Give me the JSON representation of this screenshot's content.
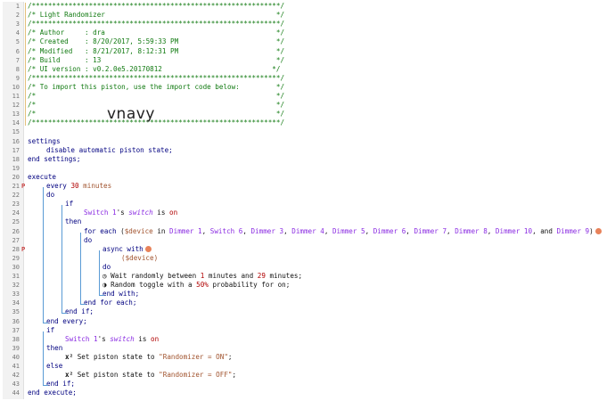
{
  "watermark": "vnavy",
  "lines": [
    {
      "n": "1",
      "indent": 0,
      "cls": "cm",
      "text": "/*************************************************************/"
    },
    {
      "n": "2",
      "indent": 0,
      "cls": "cm",
      "text": "/* Light Randomizer                                          */"
    },
    {
      "n": "3",
      "indent": 0,
      "cls": "cm",
      "text": "/*************************************************************/"
    },
    {
      "n": "4",
      "indent": 0,
      "cls": "cm",
      "text": "/* Author     : dra                                          */"
    },
    {
      "n": "5",
      "indent": 0,
      "cls": "cm",
      "text": "/* Created    : 8/20/2017, 5:59:33 PM                        */"
    },
    {
      "n": "6",
      "indent": 0,
      "cls": "cm",
      "text": "/* Modified   : 8/21/2017, 8:12:31 PM                        */"
    },
    {
      "n": "7",
      "indent": 0,
      "cls": "cm",
      "text": "/* Build      : 13                                           */"
    },
    {
      "n": "8",
      "indent": 0,
      "cls": "cm",
      "text": "/* UI version : v0.2.0e5.20170812                           */"
    },
    {
      "n": "9",
      "indent": 0,
      "cls": "cm",
      "text": "/*************************************************************/"
    },
    {
      "n": "10",
      "indent": 0,
      "cls": "cm",
      "text": "/* To import this piston, use the import code below:         */"
    },
    {
      "n": "11",
      "indent": 0,
      "cls": "cm",
      "text": "/*                                                           */"
    },
    {
      "n": "12",
      "indent": 0,
      "cls": "cm",
      "text": "/*                                                           */"
    },
    {
      "n": "13",
      "indent": 0,
      "cls": "cm",
      "text": "/*                                                           */"
    },
    {
      "n": "14",
      "indent": 0,
      "cls": "cm",
      "text": "/*************************************************************/"
    },
    {
      "n": "15",
      "indent": 0,
      "cls": "",
      "text": ""
    },
    {
      "n": "16",
      "indent": 0,
      "cls": "kw",
      "text": "settings"
    },
    {
      "n": "17",
      "indent": 1,
      "cls": "kw",
      "text": "disable automatic piston state;"
    },
    {
      "n": "18",
      "indent": 0,
      "cls": "kw",
      "text": "end settings;"
    },
    {
      "n": "19",
      "indent": 0,
      "cls": "",
      "text": ""
    },
    {
      "n": "20",
      "indent": 0,
      "cls": "kw",
      "text": "execute"
    },
    {
      "n": "21",
      "indent": 1,
      "cls": "",
      "flag": "P",
      "html": "<span class='kw'>every</span> <span class='rd'>30</span> <span class='br'>minutes</span>"
    },
    {
      "n": "22",
      "indent": 1,
      "cls": "kw",
      "text": "do"
    },
    {
      "n": "23",
      "indent": 2,
      "cls": "kw",
      "text": "if"
    },
    {
      "n": "24",
      "indent": 3,
      "cls": "",
      "html": "<span class='pu'>Switch 1</span>'s <i class='pu'>switch</i> is <span class='rd'>on</span>"
    },
    {
      "n": "25",
      "indent": 2,
      "cls": "kw",
      "text": "then"
    },
    {
      "n": "26",
      "indent": 3,
      "cls": "",
      "html": "<span class='kw'>for each</span> (<span class='br'>$device</span> in <span class='pu'>Dimmer 1</span>, <span class='pu'>Switch 6</span>, <span class='pu'>Dimmer 3</span>, <span class='pu'>Dimmer 4</span>, <span class='pu'>Dimmer 5</span>, <span class='pu'>Dimmer 6</span>, <span class='pu'>Dimmer 7</span>, <span class='pu'>Dimmer 8</span>, <span class='pu'>Dimmer 10</span>, and <span class='pu'>Dimmer 9</span>)<span class='badge'></span>"
    },
    {
      "n": "27",
      "indent": 3,
      "cls": "kw",
      "text": "do"
    },
    {
      "n": "28",
      "indent": 4,
      "cls": "",
      "flag": "P",
      "html": "<span class='kw'>async with</span><span class='badge'></span>"
    },
    {
      "n": "29",
      "indent": 5,
      "cls": "br",
      "text": "($device)"
    },
    {
      "n": "30",
      "indent": 4,
      "cls": "kw",
      "text": "do"
    },
    {
      "n": "31",
      "indent": 4,
      "cls": "",
      "html": "<span class='ico'>&#9719;</span> Wait randomly between <span class='rd'>1</span> minutes and <span class='rd'>29</span> minutes;"
    },
    {
      "n": "32",
      "indent": 4,
      "cls": "",
      "html": "<span class='ico'>&#9681;</span> Random toggle with a <span class='rd'>50%</span> probability for on;"
    },
    {
      "n": "33",
      "indent": 4,
      "cls": "kw",
      "text": "end with;"
    },
    {
      "n": "34",
      "indent": 3,
      "cls": "kw",
      "text": "end for each;"
    },
    {
      "n": "35",
      "indent": 2,
      "cls": "kw",
      "text": "end if;"
    },
    {
      "n": "36",
      "indent": 1,
      "cls": "kw",
      "text": "end every;"
    },
    {
      "n": "37",
      "indent": 1,
      "cls": "kw",
      "text": "if"
    },
    {
      "n": "38",
      "indent": 2,
      "cls": "",
      "html": "<span class='pu'>Switch 1</span>'s <i class='pu'>switch</i> is <span class='rd'>on</span>"
    },
    {
      "n": "39",
      "indent": 1,
      "cls": "kw",
      "text": "then"
    },
    {
      "n": "40",
      "indent": 2,
      "cls": "",
      "html": "<b>x&#178;</b> Set piston state to <span class='br'>\"Randomizer = ON\"</span>;"
    },
    {
      "n": "41",
      "indent": 1,
      "cls": "kw",
      "text": "else"
    },
    {
      "n": "42",
      "indent": 2,
      "cls": "",
      "html": "<b>x&#178;</b> Set piston state to <span class='br'>\"Randomizer = OFF\"</span>;"
    },
    {
      "n": "43",
      "indent": 1,
      "cls": "kw",
      "text": "end if;"
    },
    {
      "n": "44",
      "indent": 0,
      "cls": "kw",
      "text": "end execute;"
    }
  ]
}
